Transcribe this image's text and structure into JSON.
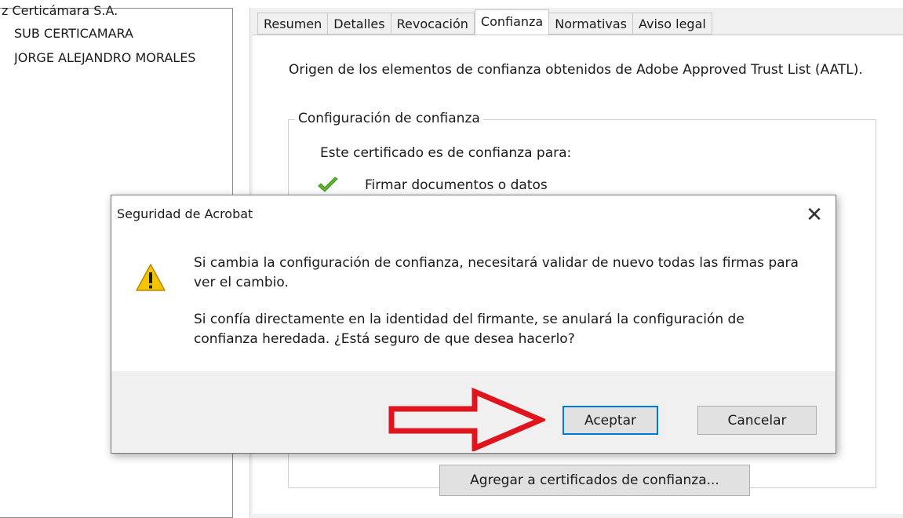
{
  "tree": {
    "items": [
      "z Certicámara S.A.",
      "SUB CERTICAMARA",
      "JORGE ALEJANDRO MORALES"
    ]
  },
  "tabs": [
    {
      "label": "Resumen",
      "active": false
    },
    {
      "label": "Detalles",
      "active": false
    },
    {
      "label": "Revocación",
      "active": false
    },
    {
      "label": "Confianza",
      "active": true
    },
    {
      "label": "Normativas",
      "active": false
    },
    {
      "label": "Aviso legal",
      "active": false
    }
  ],
  "trust": {
    "origin_text": "Origen de los elementos de confianza obtenidos de Adobe Approved Trust List (AATL).",
    "group_title": "Configuración de confianza",
    "trusted_for": "Este certificado es de confianza para:",
    "sign_item": "Firmar documentos o datos",
    "add_button": "Agregar a certificados de confianza..."
  },
  "dialog": {
    "title": "Seguridad de Acrobat",
    "close_symbol": "✕",
    "message1": "Si cambia la configuración de confianza, necesitará validar de nuevo todas las firmas para ver el cambio.",
    "message2": "Si confía directamente en la identidad del firmante, se anulará la configuración de confianza heredada. ¿Está seguro de que desea hacerlo?",
    "ok_label": "Aceptar",
    "cancel_label": "Cancelar"
  },
  "colors": {
    "accent": "#0078d7",
    "arrow": "#e0141c",
    "warning": "#f5c400",
    "check": "#4caf2a"
  }
}
